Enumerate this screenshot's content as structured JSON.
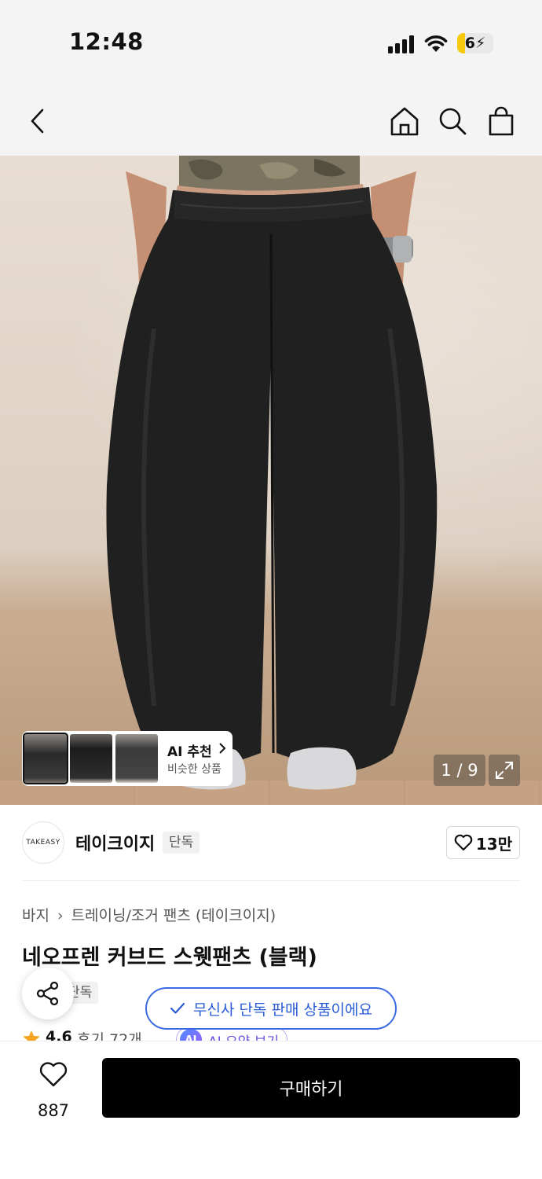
{
  "status_bar": {
    "time": "12:48",
    "battery": "6"
  },
  "gallery": {
    "counter": "1 / 9",
    "ai_recommend": {
      "title": "AI 추천",
      "subtitle": "비슷한 상품"
    }
  },
  "brand": {
    "logo_text": "TAKEASY",
    "name": "테이크이지",
    "badge": "단독",
    "likes": "13만"
  },
  "breadcrumb": {
    "category": "바지",
    "subcategory": "트레이닝/조거 팬츠 (테이크이지)"
  },
  "product": {
    "title": "네오프렌 커브드 스웻팬츠 (블랙)",
    "exclusive_badge": "단독",
    "rating": "4.6",
    "review_count": "후기 72개",
    "ai_summary": "AI 요약 보기",
    "ai_badge": "AI"
  },
  "toast": {
    "text": "무신사 단독 판매 상품이에요"
  },
  "bottom_bar": {
    "wish_count": "887",
    "buy_label": "구매하기"
  },
  "colors": {
    "accent_blue": "#2a5bd7",
    "ai_purple": "#6a4fe0",
    "star": "#f5a623",
    "buy_button": "#000000"
  },
  "icons": [
    "back-icon",
    "home-icon",
    "search-icon",
    "shopping-bag-icon",
    "expand-icon",
    "share-icon",
    "heart-icon",
    "check-icon",
    "star-icon"
  ]
}
